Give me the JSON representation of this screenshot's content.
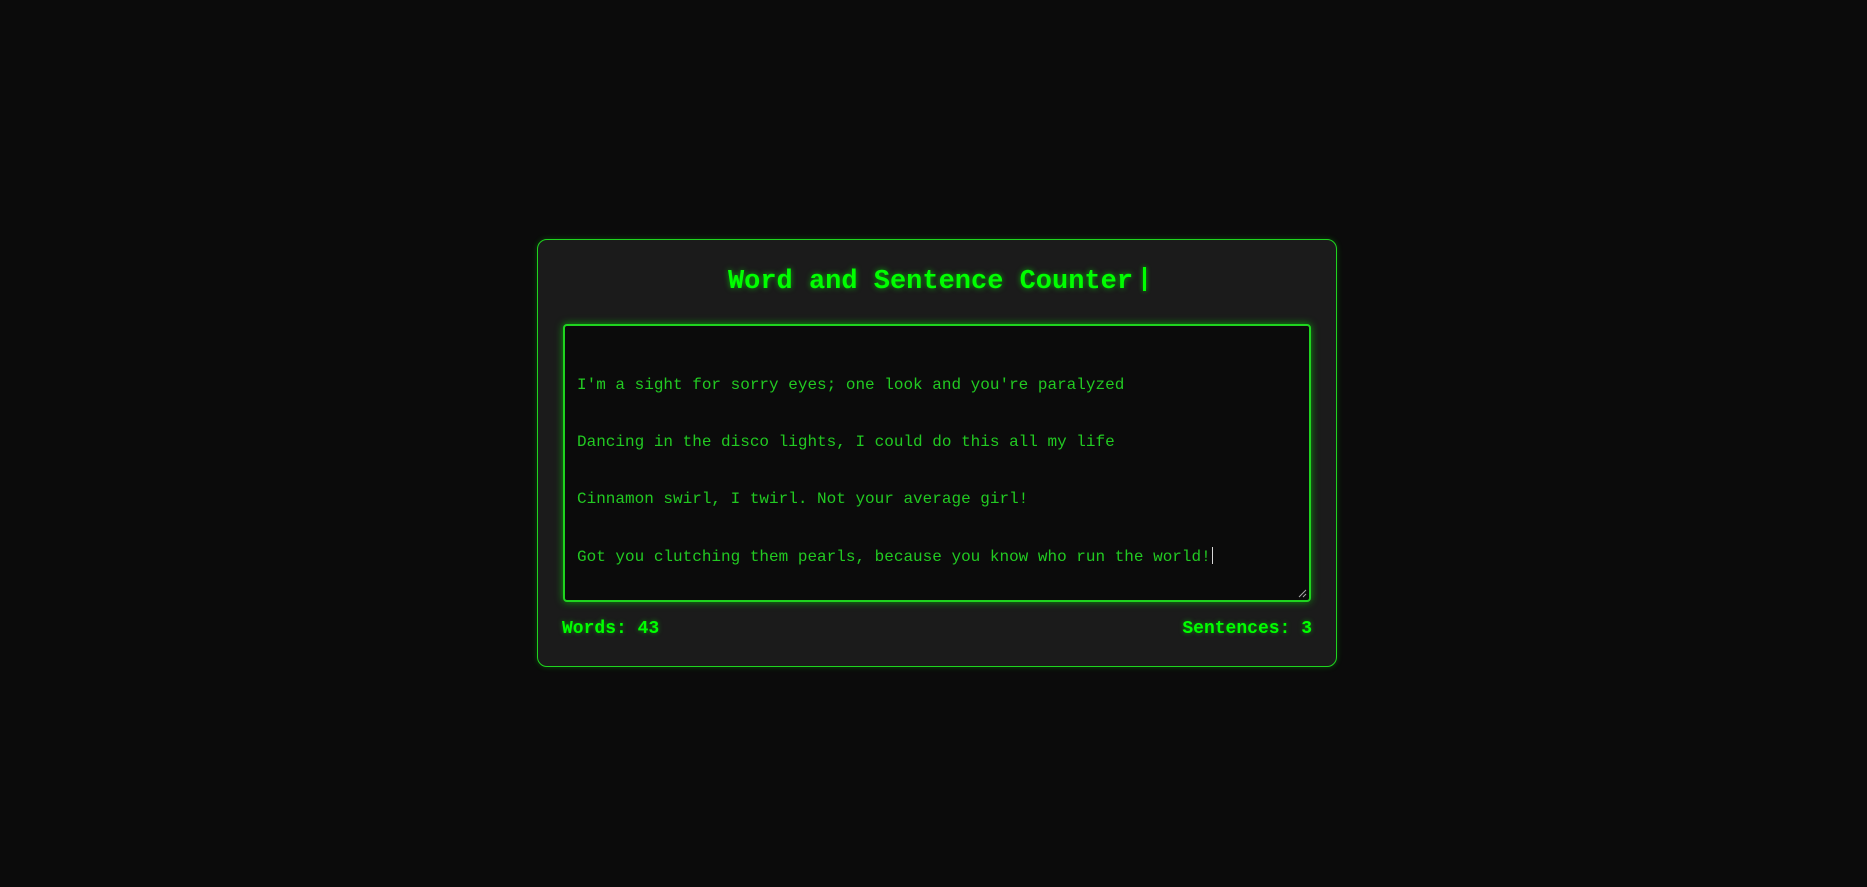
{
  "app": {
    "title": "Word and Sentence Counter"
  },
  "editor": {
    "lines": [
      "I'm a sight for sorry eyes; one look and you're paralyzed",
      "Dancing in the disco lights, I could do this all my life",
      "Cinnamon swirl, I twirl. Not your average girl!",
      "Got you clutching them pearls, because you know who run the world!"
    ]
  },
  "stats": {
    "words_label": "Words:",
    "words_value": "43",
    "sentences_label": "Sentences:",
    "sentences_value": "3"
  },
  "colors": {
    "accent": "#00ff00",
    "text": "#22c922",
    "card_background": "#1b1b1b",
    "page_background": "#0b0b0b"
  }
}
